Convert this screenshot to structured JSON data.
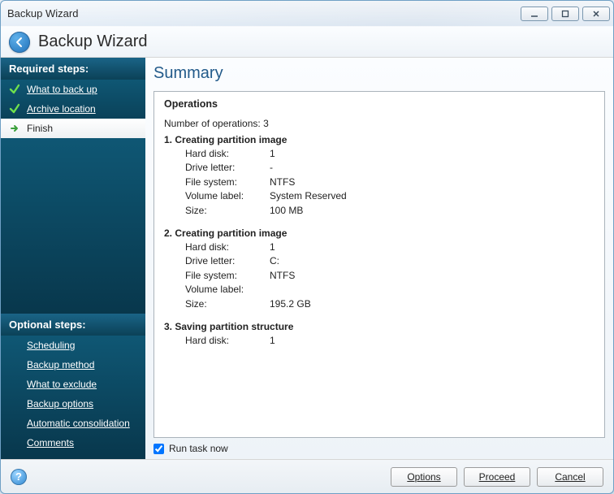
{
  "window": {
    "title": "Backup Wizard"
  },
  "header": {
    "back_label": "Back",
    "title": "Backup Wizard"
  },
  "sidebar": {
    "required_title": "Required steps:",
    "optional_title": "Optional steps:",
    "required": [
      {
        "icon": "check",
        "label": "What to back up",
        "current": false
      },
      {
        "icon": "check",
        "label": "Archive location",
        "current": false
      },
      {
        "icon": "arrow",
        "label": "Finish",
        "current": true
      }
    ],
    "optional": [
      {
        "label": "Scheduling"
      },
      {
        "label": "Backup method"
      },
      {
        "label": "What to exclude"
      },
      {
        "label": "Backup options"
      },
      {
        "label": "Automatic consolidation"
      },
      {
        "label": "Comments"
      }
    ]
  },
  "summary": {
    "title": "Summary",
    "operations_heading": "Operations",
    "count_label": "Number of operations:",
    "count_value": "3",
    "ops": [
      {
        "n": "1.",
        "title": "Creating partition image",
        "rows": [
          {
            "k": "Hard disk:",
            "v": "1"
          },
          {
            "k": "Drive letter:",
            "v": "-"
          },
          {
            "k": "File system:",
            "v": "NTFS"
          },
          {
            "k": "Volume label:",
            "v": "System Reserved"
          },
          {
            "k": "Size:",
            "v": "100 MB"
          }
        ]
      },
      {
        "n": "2.",
        "title": "Creating partition image",
        "rows": [
          {
            "k": "Hard disk:",
            "v": "1"
          },
          {
            "k": "Drive letter:",
            "v": "C:"
          },
          {
            "k": "File system:",
            "v": "NTFS"
          },
          {
            "k": "Volume label:",
            "v": ""
          },
          {
            "k": "Size:",
            "v": "195.2 GB"
          }
        ]
      },
      {
        "n": "3.",
        "title": "Saving partition structure",
        "rows": [
          {
            "k": "Hard disk:",
            "v": "1"
          }
        ]
      }
    ],
    "run_now_label": "Run task now",
    "run_now_checked": true
  },
  "footer": {
    "help_tooltip": "Help",
    "options": "Options",
    "proceed": "Proceed",
    "cancel": "Cancel"
  }
}
